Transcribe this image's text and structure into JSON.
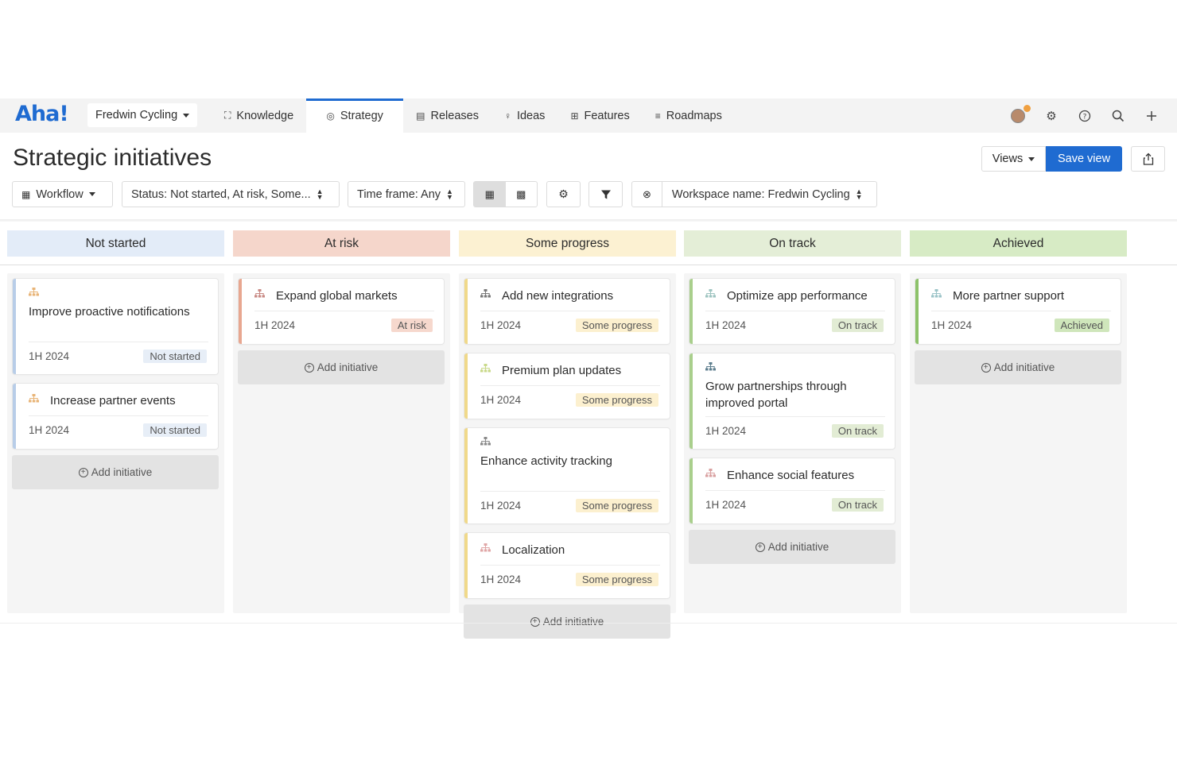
{
  "app": {
    "logo": "Aha!",
    "workspace": "Fredwin Cycling",
    "nav_tabs": [
      {
        "label": "Knowledge",
        "icon": "knowledge-icon"
      },
      {
        "label": "Strategy",
        "icon": "target-icon"
      },
      {
        "label": "Releases",
        "icon": "calendar-icon"
      },
      {
        "label": "Ideas",
        "icon": "lightbulb-icon"
      },
      {
        "label": "Features",
        "icon": "grid-icon"
      },
      {
        "label": "Roadmaps",
        "icon": "roadmap-icon"
      }
    ],
    "active_tab": "Strategy",
    "accent": "#1f6bd1"
  },
  "header": {
    "title": "Strategic initiatives",
    "views_label": "Views",
    "save_label": "Save view"
  },
  "filters": {
    "workflow": "Workflow",
    "status": "Status: Not started, At risk, Some...",
    "timeframe": "Time frame: Any",
    "workspace": "Workspace name: Fredwin Cycling"
  },
  "add_label": "Add initiative",
  "columns": [
    {
      "name": "Not started",
      "head_color": "#e3ecf8",
      "border_color": "#b8cde8",
      "badge_bg": "#e7eef7",
      "cards": [
        {
          "title": "Improve proactive notifications",
          "timeframe": "1H 2024",
          "status": "Not started",
          "icon_color": "#e8b477"
        },
        {
          "title": "Increase partner events",
          "timeframe": "1H 2024",
          "status": "Not started",
          "icon_color": "#e8b477"
        }
      ]
    },
    {
      "name": "At risk",
      "head_color": "#f5d6cb",
      "border_color": "#e8a790",
      "badge_bg": "#f6d8cd",
      "cards": [
        {
          "title": "Expand global markets",
          "timeframe": "1H 2024",
          "status": "At risk",
          "icon_color": "#c98b86"
        }
      ]
    },
    {
      "name": "Some progress",
      "head_color": "#fcf1d2",
      "border_color": "#f0d98a",
      "badge_bg": "#fcf0cf",
      "cards": [
        {
          "title": "Add new integrations",
          "timeframe": "1H 2024",
          "status": "Some progress",
          "icon_color": "#7a7a7a"
        },
        {
          "title": "Premium plan updates",
          "timeframe": "1H 2024",
          "status": "Some progress",
          "icon_color": "#c9d98a"
        },
        {
          "title": "Enhance activity tracking",
          "timeframe": "1H 2024",
          "status": "Some progress",
          "icon_color": "#8a8a8a"
        },
        {
          "title": "Localization",
          "timeframe": "1H 2024",
          "status": "Some progress",
          "icon_color": "#e0a7a7"
        }
      ]
    },
    {
      "name": "On track",
      "head_color": "#e4eed7",
      "border_color": "#a9cf8c",
      "badge_bg": "#e2ecd4",
      "cards": [
        {
          "title": "Optimize app performance",
          "timeframe": "1H 2024",
          "status": "On track",
          "icon_color": "#9ec4c0"
        },
        {
          "title": "Grow partnerships through improved portal",
          "timeframe": "1H 2024",
          "status": "On track",
          "icon_color": "#5f7f8f"
        },
        {
          "title": "Enhance social features",
          "timeframe": "1H 2024",
          "status": "On track",
          "icon_color": "#d9a0a0"
        }
      ]
    },
    {
      "name": "Achieved",
      "head_color": "#d7ebc5",
      "border_color": "#8dc26a",
      "badge_bg": "#cfe6bb",
      "cards": [
        {
          "title": "More partner support",
          "timeframe": "1H 2024",
          "status": "Achieved",
          "icon_color": "#9cc4c8"
        }
      ]
    }
  ]
}
